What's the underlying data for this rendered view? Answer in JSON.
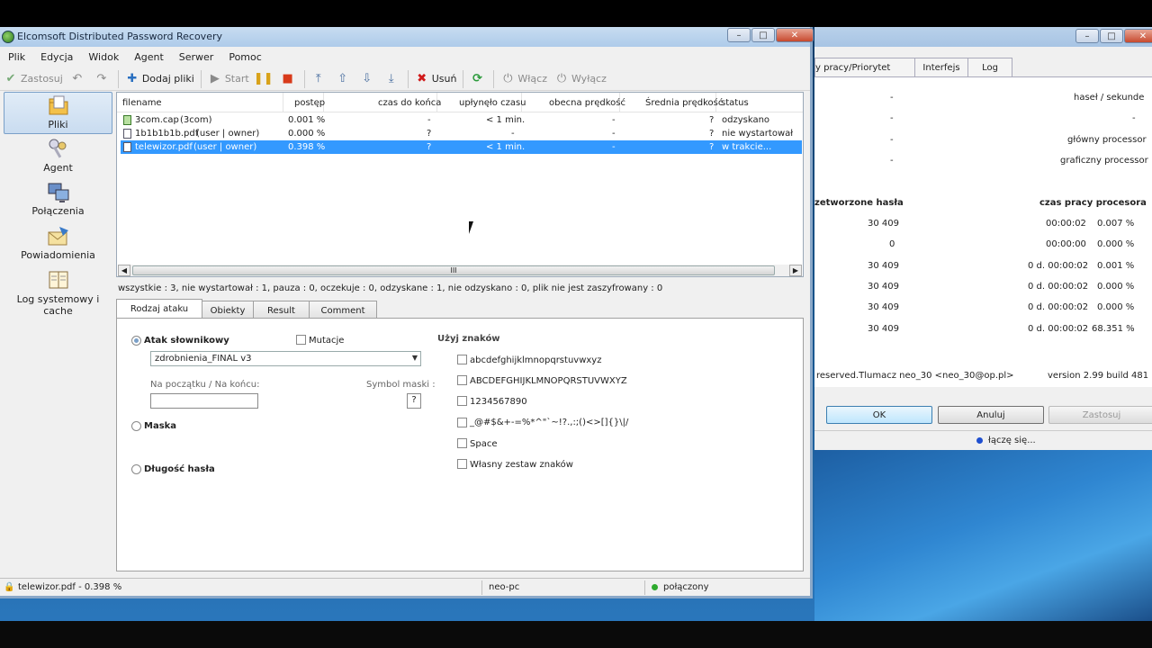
{
  "window": {
    "title": "Elcomsoft Distributed Password Recovery",
    "controls": {
      "minimize": "–",
      "maximize": "□",
      "close": "✕"
    }
  },
  "menu": [
    "Plik",
    "Edycja",
    "Widok",
    "Agent",
    "Serwer",
    "Pomoc"
  ],
  "toolbar": {
    "apply": "Zastosuj",
    "add_files": "Dodaj pliki",
    "start": "Start",
    "remove": "Usuń",
    "enable": "Włącz",
    "disable": "Wyłącz"
  },
  "sidebar": [
    {
      "label": "Pliki"
    },
    {
      "label": "Agent"
    },
    {
      "label": "Połączenia"
    },
    {
      "label": "Powiadomienia"
    },
    {
      "label": "Log systemowy i cache"
    }
  ],
  "filelist": {
    "columns": [
      "filename",
      "postęp",
      "czas do końca",
      "upłynęło czasu",
      "obecna prędkość",
      "Średnia prędkość",
      "status"
    ],
    "rows": [
      {
        "name": "3com.cap",
        "user": "(3com)",
        "progress": "0.001 %",
        "remaining": "-",
        "elapsed": "< 1 min.",
        "current": "-",
        "average": "?",
        "status": "odzyskano"
      },
      {
        "name": "1b1b1b1b.pdf",
        "user": "(user | owner)",
        "progress": "0.000 %",
        "remaining": "?",
        "elapsed": "-",
        "current": "-",
        "average": "?",
        "status": "nie wystartował"
      },
      {
        "name": "telewizor.pdf",
        "user": "(user | owner)",
        "progress": "0.398 %",
        "remaining": "?",
        "elapsed": "< 1 min.",
        "current": "-",
        "average": "?",
        "status": "w trakcie..."
      }
    ],
    "scroll_grip": "III"
  },
  "summary": "wszystkie : 3,   nie wystartował : 1,   pauza : 0,   oczekuje : 0,   odzyskane : 1,   nie odzyskano : 0,   plik nie jest zaszyfrowany : 0",
  "tabs": [
    "Rodzaj ataku",
    "Obiekty",
    "Result",
    "Comment"
  ],
  "attack": {
    "dictionary": "Atak słownikowy",
    "mutations": "Mutacje",
    "dict_value": "zdrobnienia_FINAL v3",
    "start_end_label": "Na początku / Na końcu:",
    "mask_symbol_label": "Symbol maski :",
    "mask_symbol_value": "?",
    "mask": "Maska",
    "length": "Długość hasła",
    "charset_title": "Użyj znaków",
    "charsets": [
      "abcdefghijklmnopqrstuvwxyz",
      "ABCDEFGHIJKLMNOPQRSTUVWXYZ",
      "1234567890",
      "_@#$&+-=%*^\"`~!?.,:;()<>[]{}\\|/",
      "Space",
      "Własny zestaw znaków"
    ]
  },
  "statusbar": {
    "file": "telewizor.pdf  -  0.398 %",
    "host": "neo-pc",
    "connection": "połączony"
  },
  "back_window": {
    "tabs": [
      "y pracy/Priorytet",
      "Interfejs",
      "Log"
    ],
    "rows1": [
      {
        "a": "-",
        "b": "haseł / sekunde"
      },
      {
        "a": "-",
        "b": "-"
      },
      {
        "a": "-",
        "b": "główny processor"
      },
      {
        "a": "-",
        "b": "graficzny processor"
      }
    ],
    "header_left": "zetworzone hasła",
    "header_right": "czas pracy procesora",
    "rows2": [
      {
        "a": "30 409",
        "t": "00:00:02",
        "p": "0.007 %"
      },
      {
        "a": "0",
        "t": "00:00:00",
        "p": "0.000 %"
      },
      {
        "a": "30 409",
        "t": "0 d. 00:00:02",
        "p": "0.001 %"
      },
      {
        "a": "30 409",
        "t": "0 d. 00:00:02",
        "p": "0.000 %"
      },
      {
        "a": "30 409",
        "t": "0 d. 00:00:02",
        "p": "0.000 %"
      },
      {
        "a": "30 409",
        "t": "0 d. 00:00:02",
        "p": "68.351 %"
      }
    ],
    "copyright": "reserved.Tlumacz neo_30 <neo_30@op.pl>",
    "version": "version 2.99  build 481",
    "ok": "OK",
    "cancel": "Anuluj",
    "apply": "Zastosuj",
    "status": "łączę się..."
  },
  "colors": {
    "selection": "#3399ff",
    "connected": "#2eaa2e",
    "connecting": "#1f4fd0"
  }
}
